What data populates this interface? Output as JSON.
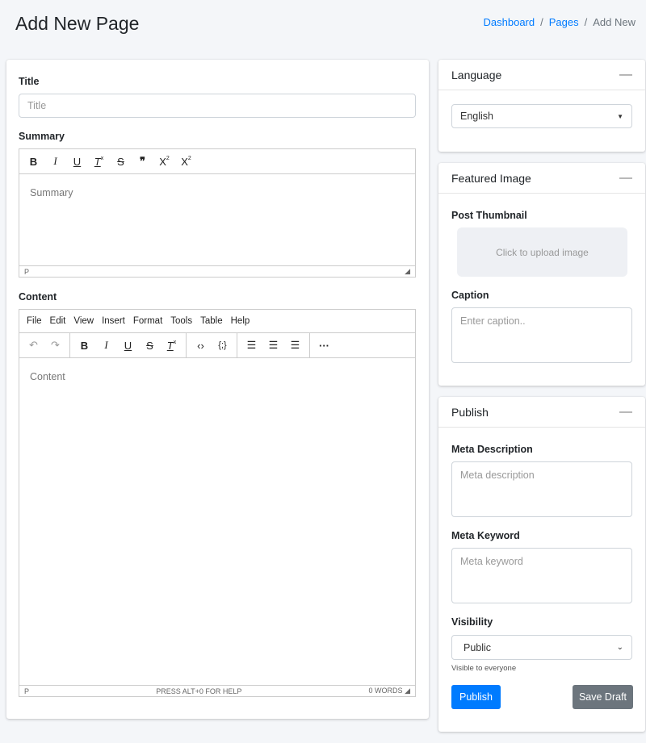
{
  "header": {
    "title": "Add New Page",
    "breadcrumb": [
      "Dashboard",
      "Pages",
      "Add New"
    ]
  },
  "main": {
    "title_label": "Title",
    "title_placeholder": "Title",
    "summary_label": "Summary",
    "summary_placeholder": "Summary",
    "summary_status": "P",
    "summary_toolbar": [
      "bold-icon",
      "italic-icon",
      "underline-icon",
      "clear-format-icon",
      "strikethrough-icon",
      "blockquote-icon",
      "superscript-icon",
      "subscript-icon"
    ],
    "content_label": "Content",
    "content_placeholder": "Content",
    "menu": [
      "File",
      "Edit",
      "View",
      "Insert",
      "Format",
      "Tools",
      "Table",
      "Help"
    ],
    "content_status": {
      "path": "P",
      "help": "PRESS ALT+0 FOR HELP",
      "words": "0 WORDS"
    }
  },
  "language": {
    "title": "Language",
    "selected": "English"
  },
  "featured": {
    "title": "Featured Image",
    "thumb_label": "Post Thumbnail",
    "upload_text": "Click to upload image",
    "caption_label": "Caption",
    "caption_placeholder": "Enter caption.."
  },
  "publish": {
    "title": "Publish",
    "meta_desc_label": "Meta Description",
    "meta_desc_placeholder": "Meta description",
    "meta_kw_label": "Meta Keyword",
    "meta_kw_placeholder": "Meta keyword",
    "visibility_label": "Visibility",
    "visibility": "Public",
    "visibility_help": "Visible to everyone",
    "publish_btn": "Publish",
    "draft_btn": "Save Draft",
    "primary_color": "#007bff",
    "secondary_color": "#6c757d"
  }
}
